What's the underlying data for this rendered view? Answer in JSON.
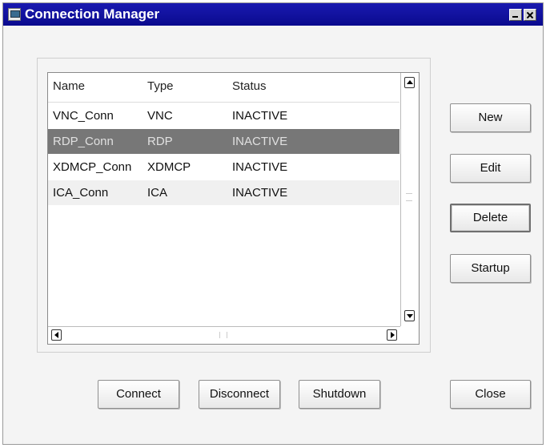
{
  "window": {
    "title": "Connection Manager",
    "icon": "app-window-icon"
  },
  "list": {
    "columns": [
      "Name",
      "Type",
      "Status"
    ],
    "rows": [
      {
        "name": "VNC_Conn",
        "type": "VNC",
        "status": "INACTIVE"
      },
      {
        "name": "RDP_Conn",
        "type": "RDP",
        "status": "INACTIVE"
      },
      {
        "name": "XDMCP_Conn",
        "type": "XDMCP",
        "status": "INACTIVE"
      },
      {
        "name": "ICA_Conn",
        "type": "ICA",
        "status": "INACTIVE"
      }
    ],
    "selected_row": 1
  },
  "side_buttons": {
    "new": "New",
    "edit": "Edit",
    "delete": "Delete",
    "startup": "Startup"
  },
  "bottom_buttons": {
    "connect": "Connect",
    "disconnect": "Disconnect",
    "shutdown": "Shutdown",
    "close": "Close"
  },
  "colors": {
    "titlebar": "#0a0a8e",
    "selection": "#777777",
    "window_bg": "#f4f4f4"
  }
}
